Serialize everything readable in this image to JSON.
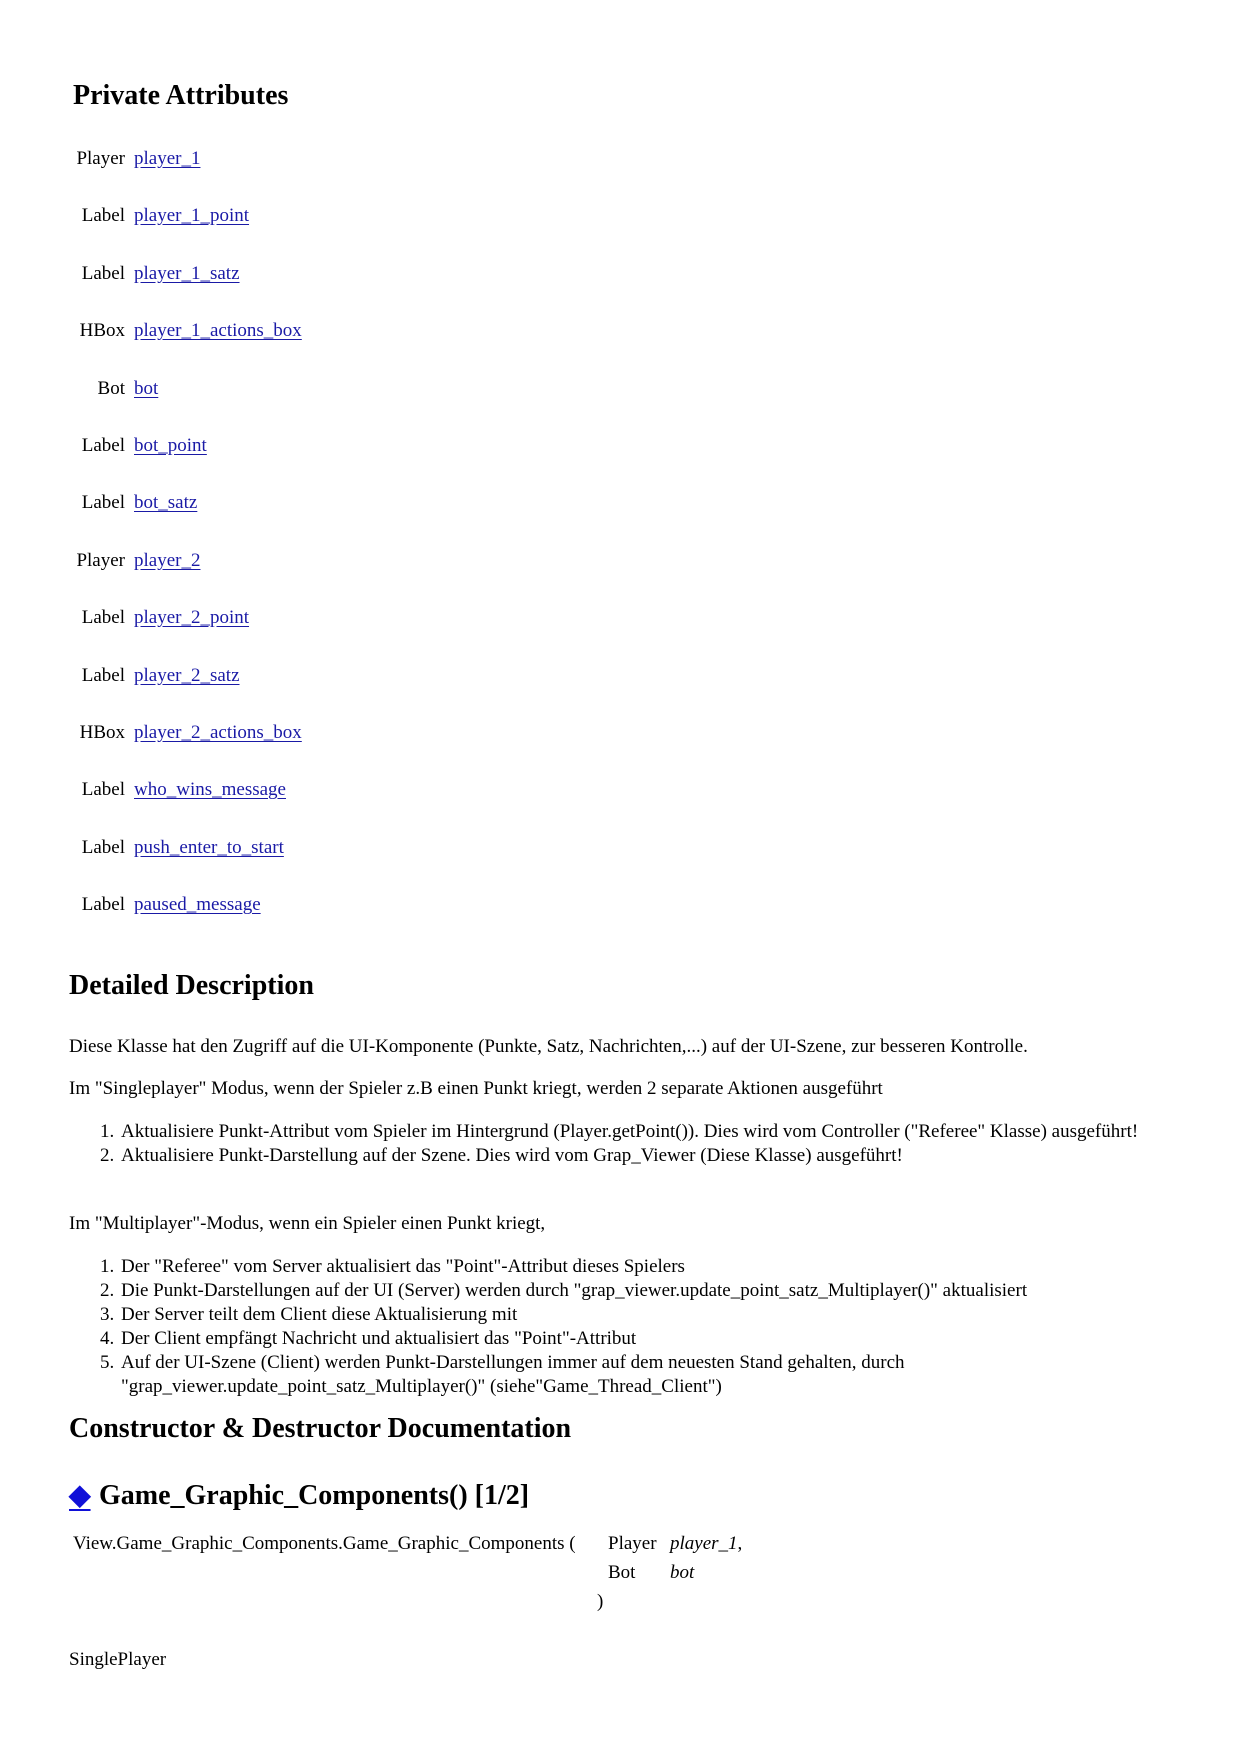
{
  "private_attributes": {
    "title": "Private Attributes",
    "rows": [
      {
        "type": "Player",
        "name": "player_1"
      },
      {
        "type": "Label",
        "name": "player_1_point"
      },
      {
        "type": "Label",
        "name": "player_1_satz"
      },
      {
        "type": "HBox",
        "name": "player_1_actions_box"
      },
      {
        "type": "Bot",
        "name": "bot"
      },
      {
        "type": "Label",
        "name": "bot_point"
      },
      {
        "type": "Label",
        "name": "bot_satz"
      },
      {
        "type": "Player",
        "name": "player_2"
      },
      {
        "type": "Label",
        "name": "player_2_point"
      },
      {
        "type": "Label",
        "name": "player_2_satz"
      },
      {
        "type": "HBox",
        "name": "player_2_actions_box"
      },
      {
        "type": "Label",
        "name": "who_wins_message"
      },
      {
        "type": "Label",
        "name": "push_enter_to_start"
      },
      {
        "type": "Label",
        "name": "paused_message"
      }
    ]
  },
  "detailed_description": {
    "title": "Detailed Description",
    "intro": "Diese Klasse hat den Zugriff auf die UI-Komponente (Punkte, Satz, Nachrichten,...) auf der UI-Szene, zur besseren Kontrolle.",
    "singleplayer_intro": "Im \"Singleplayer\" Modus, wenn der Spieler z.B einen Punkt kriegt, werden 2 separate Aktionen ausgeführt",
    "singleplayer_steps": [
      "Aktualisiere Punkt-Attribut vom Spieler im Hintergrund (Player.getPoint()). Dies wird vom Controller (\"Referee\" Klasse) ausgeführt!",
      "Aktualisiere Punkt-Darstellung auf der Szene. Dies wird vom Grap_Viewer (Diese Klasse) ausgeführt!"
    ],
    "multiplayer_intro": "Im \"Multiplayer\"-Modus, wenn ein Spieler einen Punkt kriegt,",
    "multiplayer_steps": [
      "Der \"Referee\" vom Server aktualisiert das \"Point\"-Attribut dieses Spielers",
      "Die Punkt-Darstellungen auf der UI (Server) werden durch \"grap_viewer.update_point_satz_Multiplayer()\" aktualisiert",
      "Der Server teilt dem Client diese Aktualisierung mit",
      "Der Client empfängt Nachricht und aktualisiert das \"Point\"-Attribut",
      "Auf der UI-Szene (Client) werden Punkt-Darstellungen immer auf dem neuesten Stand gehalten, durch \"grap_viewer.update_point_satz_Multiplayer()\" (siehe\"Game_Thread_Client\")"
    ]
  },
  "constructor_section": {
    "title": "Constructor & Destructor Documentation",
    "anchor_icon": "◆",
    "member_title": "Game_Graphic_Components() [1/2]",
    "signature": {
      "function": "View.Game_Graphic_Components.Game_Graphic_Components",
      "open_paren": "(",
      "params": [
        {
          "type": "Player",
          "name": "player_1",
          "sep": ","
        },
        {
          "type": "Bot",
          "name": "bot",
          "sep": ""
        }
      ],
      "close_paren": ")"
    },
    "description": "SinglePlayer"
  },
  "colors": {
    "link": "#1a1aa6",
    "anchor": "#1010d8"
  }
}
